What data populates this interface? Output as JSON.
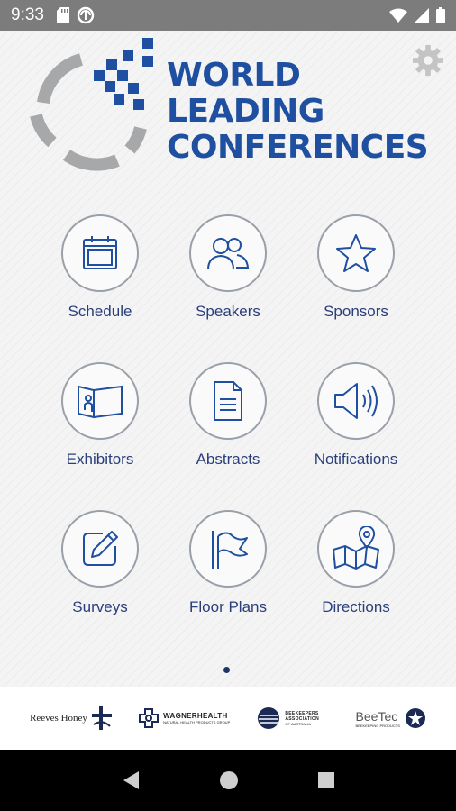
{
  "status_bar": {
    "time": "9:33"
  },
  "header": {
    "logo_line1": "WORLD",
    "logo_line2": "LEADING",
    "logo_line3": "CONFERENCES",
    "settings_icon": "gear-icon"
  },
  "menu": {
    "items": [
      {
        "label": "Schedule",
        "icon": "calendar-icon"
      },
      {
        "label": "Speakers",
        "icon": "people-icon"
      },
      {
        "label": "Sponsors",
        "icon": "star-icon"
      },
      {
        "label": "Exhibitors",
        "icon": "booth-icon"
      },
      {
        "label": "Abstracts",
        "icon": "document-icon"
      },
      {
        "label": "Notifications",
        "icon": "speaker-icon"
      },
      {
        "label": "Surveys",
        "icon": "edit-icon"
      },
      {
        "label": "Floor Plans",
        "icon": "flag-icon"
      },
      {
        "label": "Directions",
        "icon": "map-pin-icon"
      }
    ],
    "page_indicator": {
      "current": 1,
      "total": 1
    }
  },
  "sponsors": {
    "items": [
      {
        "name": "Reeves Honey"
      },
      {
        "name": "WAGNERHEALTH",
        "sub": "NATURAL HEALTH PRODUCTS GROUP"
      },
      {
        "name": "BEEKEEPERS ASSOCIATION",
        "sub": "OF AUSTRALIA"
      },
      {
        "name": "BeeTec",
        "sub": "BEEKEEPING PRODUCTS"
      }
    ]
  },
  "colors": {
    "brand_blue": "#1e4fa0",
    "label_blue": "#2a3f7a",
    "status_bar": "#7c7c7c",
    "nav_bar": "#000000"
  }
}
